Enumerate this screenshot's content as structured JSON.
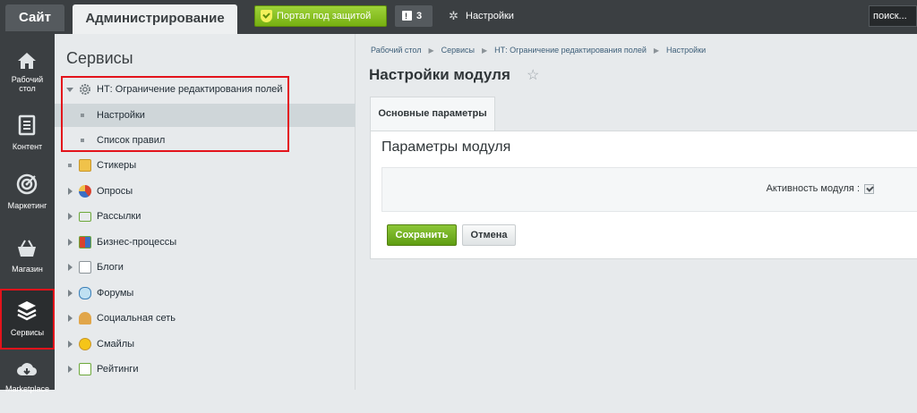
{
  "topbar": {
    "site_tab": "Сайт",
    "admin_tab": "Администрирование",
    "portal_button": "Портал под защитой",
    "notifications_count": "3",
    "settings_link": "Настройки",
    "search_placeholder": "поиск..."
  },
  "leftnav": {
    "items": [
      {
        "label_1": "Рабочий",
        "label_2": "стол",
        "icon": "home-icon"
      },
      {
        "label_1": "Контент",
        "icon": "document-icon"
      },
      {
        "label_1": "Маркетинг",
        "icon": "target-icon"
      },
      {
        "label_1": "Магазин",
        "icon": "basket-icon"
      },
      {
        "label_1": "Сервисы",
        "icon": "layers-icon",
        "active": true
      },
      {
        "label_1": "Marketplace",
        "icon": "cloud-icon"
      }
    ]
  },
  "menu": {
    "title": "Сервисы",
    "items": [
      {
        "label": "НТ: Ограничение редактирования полей",
        "expanded": true
      },
      {
        "label": "Настройки",
        "sub": true,
        "active": true
      },
      {
        "label": "Список правил",
        "sub": true
      },
      {
        "label": "Стикеры"
      },
      {
        "label": "Опросы"
      },
      {
        "label": "Рассылки"
      },
      {
        "label": "Бизнес-процессы"
      },
      {
        "label": "Блоги"
      },
      {
        "label": "Форумы"
      },
      {
        "label": "Социальная сеть"
      },
      {
        "label": "Смайлы"
      },
      {
        "label": "Рейтинги"
      }
    ]
  },
  "main": {
    "breadcrumb": [
      "Рабочий стол",
      "Сервисы",
      "НТ: Ограничение редактирования полей",
      "Настройки"
    ],
    "page_title": "Настройки модуля",
    "tab": "Основные параметры",
    "panel_title": "Параметры модуля",
    "param_label": "Активность модуля :",
    "param_checked": true,
    "save_button": "Сохранить",
    "cancel_button": "Отмена"
  },
  "colors": {
    "accent_green": "#76b011",
    "highlight_red": "#e3131b",
    "dark_bg": "#3b3f42"
  }
}
